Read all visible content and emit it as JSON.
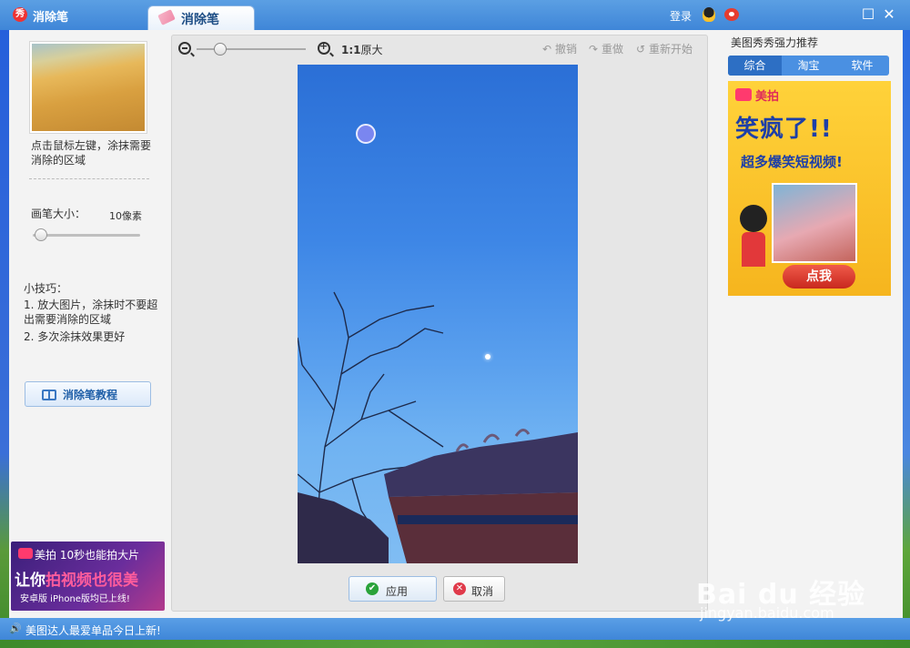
{
  "app": {
    "title": "消除笔",
    "tab_label": "消除笔",
    "login": "登录"
  },
  "left": {
    "hint": "点击鼠标左键，涂抹需要消除的区域",
    "brush_label": "画笔大小：",
    "brush_value": "10像素",
    "tips_title": "小技巧：",
    "tip1": "1. 放大图片，涂抹时不要超出需要消除的区域",
    "tip2": "2. 多次涂抹效果更好",
    "tutorial": "消除笔教程",
    "ad_line1": "美拍 10秒也能拍大片",
    "ad_line2a": "让你",
    "ad_line2b": "拍视频也很美",
    "ad_line3": "安卓版 iPhone版均已上线!"
  },
  "toolbar": {
    "ratio_bold": "1:1",
    "ratio_text": "原大",
    "undo": "撤销",
    "redo": "重做",
    "restart": "重新开始"
  },
  "actions": {
    "apply": "应用",
    "cancel": "取消"
  },
  "right": {
    "title": "美图秀秀强力推荐",
    "tabs": [
      "综合",
      "淘宝",
      "软件"
    ],
    "ad_brand": "美拍",
    "ad_head": "笑疯了!!",
    "ad_sub": "超多爆笑短视频!",
    "ad_cta": "点我"
  },
  "status": {
    "text": "美图达人最爱单品今日上新!"
  },
  "watermark": {
    "line1": "Bai du 经验",
    "line2": "jingyan.baidu.com"
  }
}
